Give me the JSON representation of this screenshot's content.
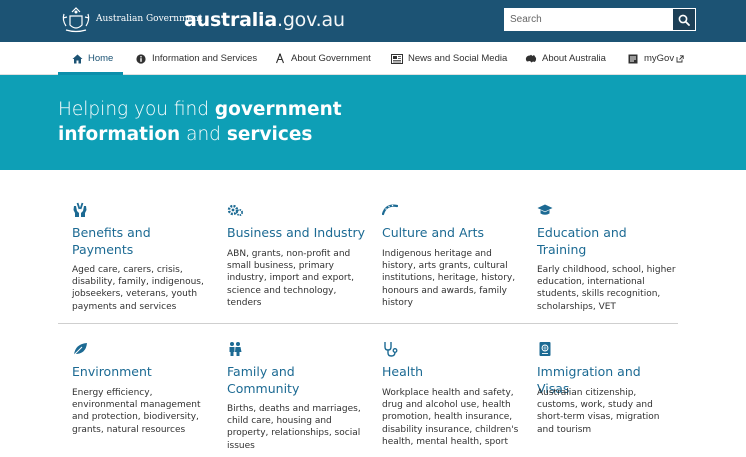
{
  "header": {
    "gov_name": "Australian Government",
    "site_name_bold": "australia",
    "site_name_rest": ".gov.au",
    "search_placeholder": "Search",
    "colors": {
      "bar": "#1c5374",
      "accent": "#0b8fab",
      "hero": "#0e9fb6"
    }
  },
  "nav": {
    "items": [
      {
        "label": "Home",
        "icon": "home-icon"
      },
      {
        "label": "Information and Services",
        "icon": "info-icon"
      },
      {
        "label": "About Government",
        "icon": "compass-icon"
      },
      {
        "label": "News and Social Media",
        "icon": "newspaper-icon"
      },
      {
        "label": "About Australia",
        "icon": "australia-map-icon"
      },
      {
        "label": "myGov",
        "icon": "mygov-icon"
      }
    ],
    "active": "Home"
  },
  "hero": {
    "line1_plain": "Helping you find ",
    "line1_bold": "government",
    "line2_bold1": "information",
    "line2_plain": " and ",
    "line2_bold2": "services"
  },
  "categories": [
    {
      "title_1": "Benefits and",
      "title_2": "Payments",
      "icon": "hands-icon",
      "desc": [
        "Aged care, carers, crisis,",
        "disability, family, indigenous,",
        "jobseekers, veterans, youth",
        "payments and services"
      ]
    },
    {
      "title_1": "Business and Industry",
      "title_2": "",
      "icon": "gears-icon",
      "desc": [
        "ABN, grants, non-profit and",
        "small business, primary",
        "industry, import and export,",
        "science and technology,",
        "tenders"
      ]
    },
    {
      "title_1": "Culture and Arts",
      "title_2": "",
      "icon": "boomerang-icon",
      "desc": [
        "Indigenous heritage and",
        "history, arts grants, cultural",
        "institutions, heritage, history,",
        "honours and awards, family",
        "history"
      ]
    },
    {
      "title_1": "Education and",
      "title_2": "Training",
      "icon": "graduation-cap-icon",
      "desc": [
        "Early childhood, school, higher",
        "education, international",
        "students, skills recognition,",
        "scholarships, VET"
      ]
    },
    {
      "title_1": "Environment",
      "title_2": "",
      "icon": "leaf-icon",
      "desc": [
        "Energy efficiency,",
        "environmental management",
        "and protection, biodiversity,",
        "grants, natural resources"
      ]
    },
    {
      "title_1": "Family and",
      "title_2": "Community",
      "icon": "family-icon",
      "desc": [
        "Births, deaths and marriages,",
        "child care, housing and",
        "property, relationships, social",
        "issues"
      ]
    },
    {
      "title_1": "Health",
      "title_2": "",
      "icon": "stethoscope-icon",
      "desc": [
        "Workplace health and safety,",
        "drug and alcohol use, health",
        "promotion, health insurance,",
        "disability insurance, children's",
        "health, mental health, sport"
      ]
    },
    {
      "title_1": "Immigration and Visas",
      "title_2": "",
      "icon": "passport-icon",
      "desc": [
        "Australian citizenship,",
        "customs, work, study and",
        "short-term visas, migration",
        "and tourism"
      ]
    }
  ]
}
